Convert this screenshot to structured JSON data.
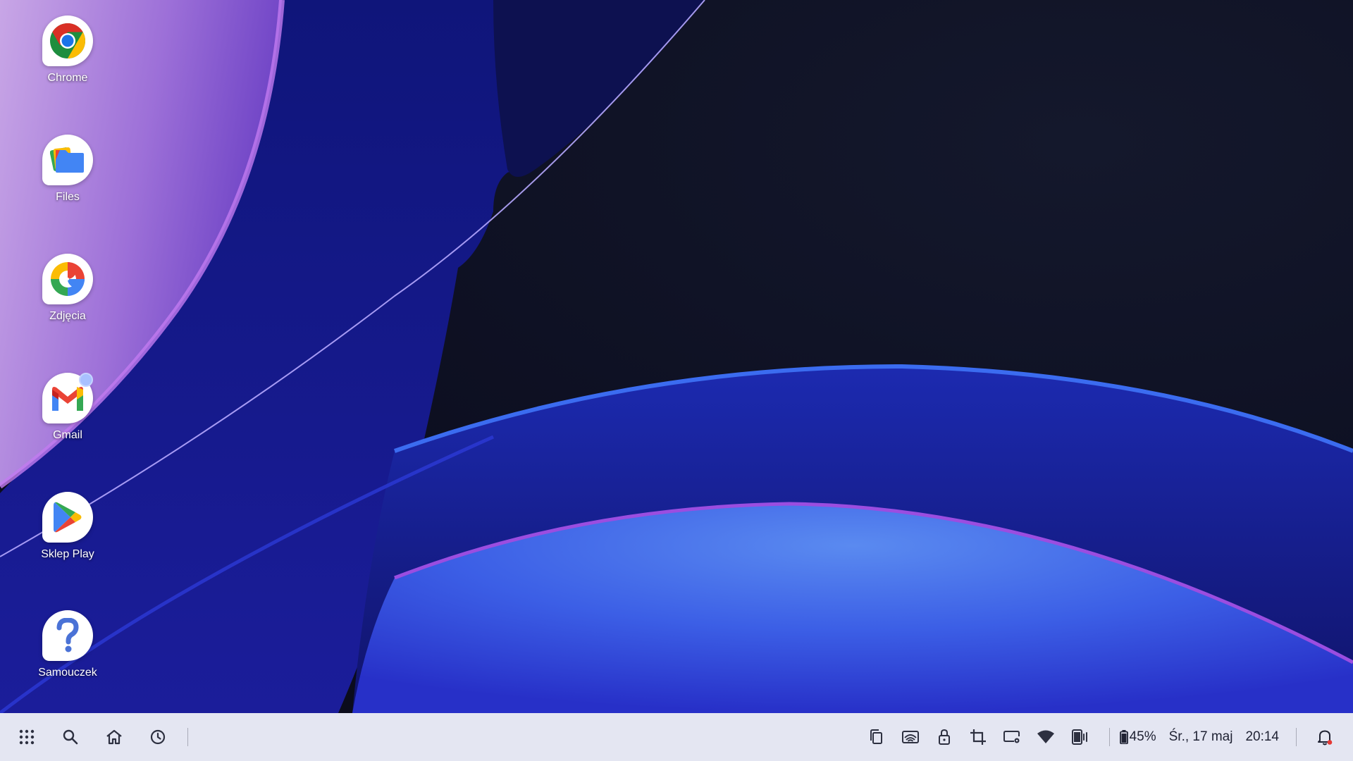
{
  "desktop": {
    "apps": [
      {
        "label": "Chrome",
        "icon": "chrome-icon"
      },
      {
        "label": "Files",
        "icon": "files-icon"
      },
      {
        "label": "Zdjęcia",
        "icon": "photos-pinwheel-icon"
      },
      {
        "label": "Gmail",
        "icon": "gmail-icon",
        "has_notification": true
      },
      {
        "label": "Sklep Play",
        "icon": "play-store-icon"
      },
      {
        "label": "Samouczek",
        "icon": "question-mark-icon"
      }
    ]
  },
  "taskbar": {
    "left_icons": [
      "apps-grid-icon",
      "search-icon",
      "home-icon",
      "recent-clock-icon"
    ],
    "tray_icons": [
      "copy-icon",
      "screen-cast-icon",
      "lock-icon",
      "crop-icon",
      "display-settings-icon",
      "wifi-icon",
      "phone-vibrate-icon"
    ],
    "battery_level": "45%",
    "date": "Śr., 17 maj",
    "time": "20:14",
    "notification_icon": "bell-icon",
    "notification_badge_color": "#e53935"
  },
  "colors": {
    "taskbar_background": "#e4e6f2",
    "wallpaper_dark": "#0c0e20",
    "wallpaper_blue": "#2a4fe0",
    "wallpaper_purple": "#9b4de0"
  }
}
